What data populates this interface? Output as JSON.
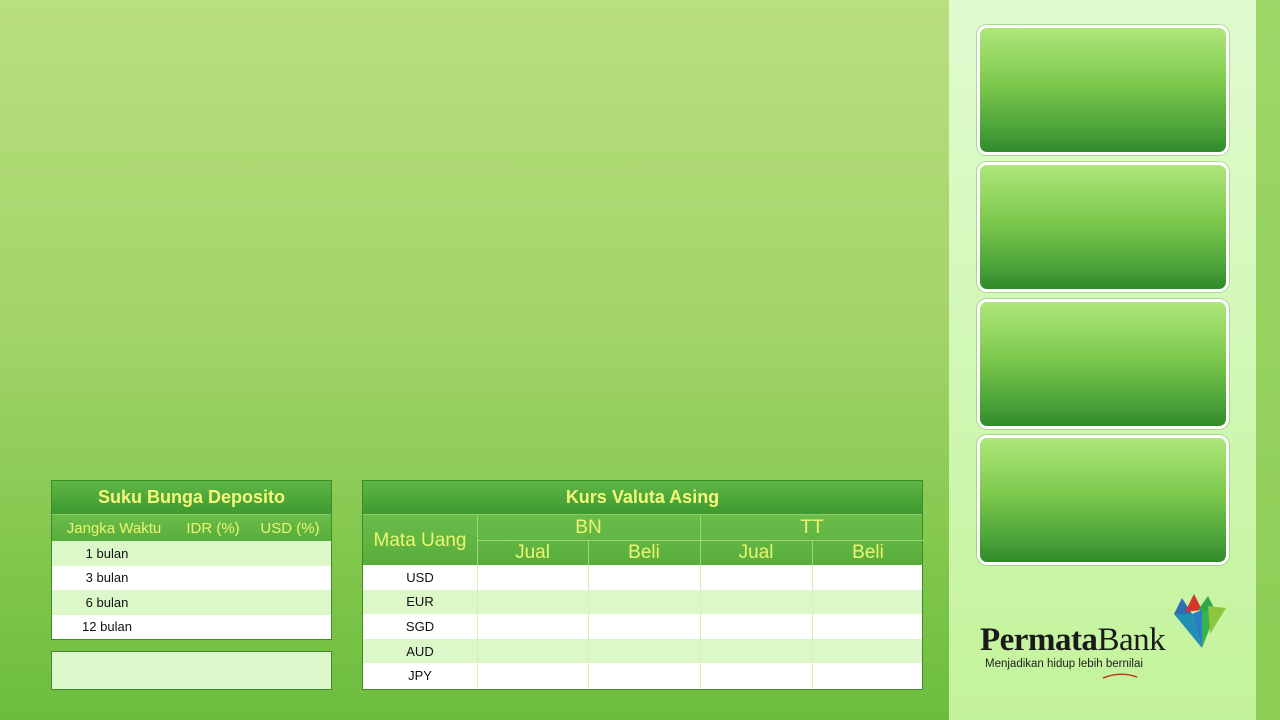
{
  "deposito": {
    "title": "Suku Bunga Deposito",
    "headers": [
      "Jangka Waktu",
      "IDR (%)",
      "USD (%)"
    ],
    "rows": [
      "1 bulan",
      "3 bulan",
      "6 bulan",
      "12 bulan"
    ]
  },
  "kurs": {
    "title": "Kurs Valuta Asing",
    "mata_uang": "Mata Uang",
    "groups": [
      "BN",
      "TT"
    ],
    "subheaders": [
      "Jual",
      "Beli",
      "Jual",
      "Beli"
    ],
    "currencies": [
      "USD",
      "EUR",
      "SGD",
      "AUD",
      "JPY"
    ]
  },
  "logo": {
    "name_bold": "Permata",
    "name_light": "Bank",
    "tagline": "Menjadikan hidup lebih bernilai"
  },
  "colors": {
    "header_text": "#f4f77a",
    "header_green": "#3e9a2f",
    "row_alt": "#dcf8c8"
  }
}
